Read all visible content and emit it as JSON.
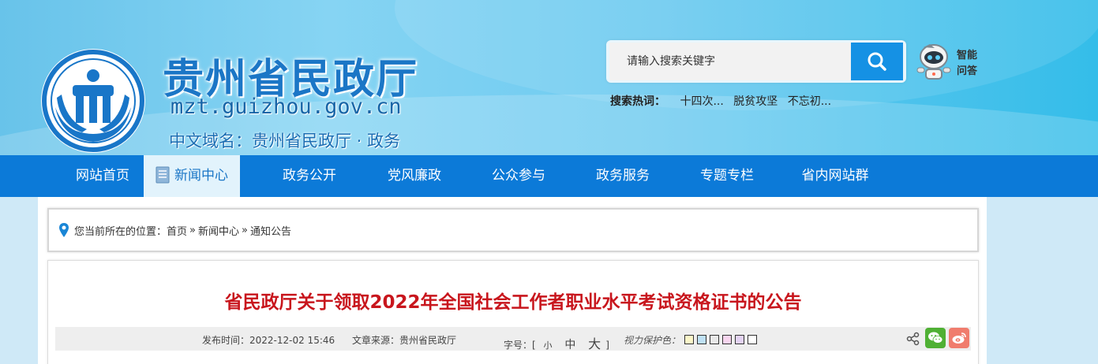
{
  "header": {
    "title": "贵州省民政厅",
    "domain": "mzt.guizhou.gov.cn",
    "cn_domain": "中文域名：贵州省民政厅 · 政务",
    "search": {
      "placeholder": "请输入搜索关键字"
    },
    "robot_label": "智能问答",
    "hot_label": "搜索热词：",
    "hot_words": [
      "十四次...",
      "脱贫攻坚",
      "不忘初..."
    ]
  },
  "nav": {
    "items": [
      {
        "label": "网站首页"
      },
      {
        "label": "新闻中心",
        "active": true
      },
      {
        "label": "政务公开"
      },
      {
        "label": "党风廉政"
      },
      {
        "label": "公众参与"
      },
      {
        "label": "政务服务"
      },
      {
        "label": "专题专栏"
      },
      {
        "label": "省内网站群"
      }
    ]
  },
  "breadcrumb": {
    "prefix": "您当前所在的位置：",
    "items": [
      "首页",
      "新闻中心",
      "通知公告"
    ],
    "separator": "»"
  },
  "article": {
    "title": "省民政厅关于领取2022年全国社会工作者职业水平考试资格证书的公告",
    "publish_time": "发布时间：2022-12-02 15:46",
    "source": "文章来源：贵州省民政厅",
    "font_size_label": "字号：",
    "font_size_options": [
      "小",
      "中",
      "大"
    ],
    "eye_care_label": "视力保护色：",
    "eye_care_colors": [
      "#fbf6c9",
      "#bfe1f5",
      "#e8e8e8",
      "#f7d5ee",
      "#e3d3f2",
      "#ffffff"
    ]
  },
  "colors": {
    "nav_bg": "#0c7ad8",
    "title_red": "#c8161d",
    "brand_blue": "#1b76c6"
  }
}
